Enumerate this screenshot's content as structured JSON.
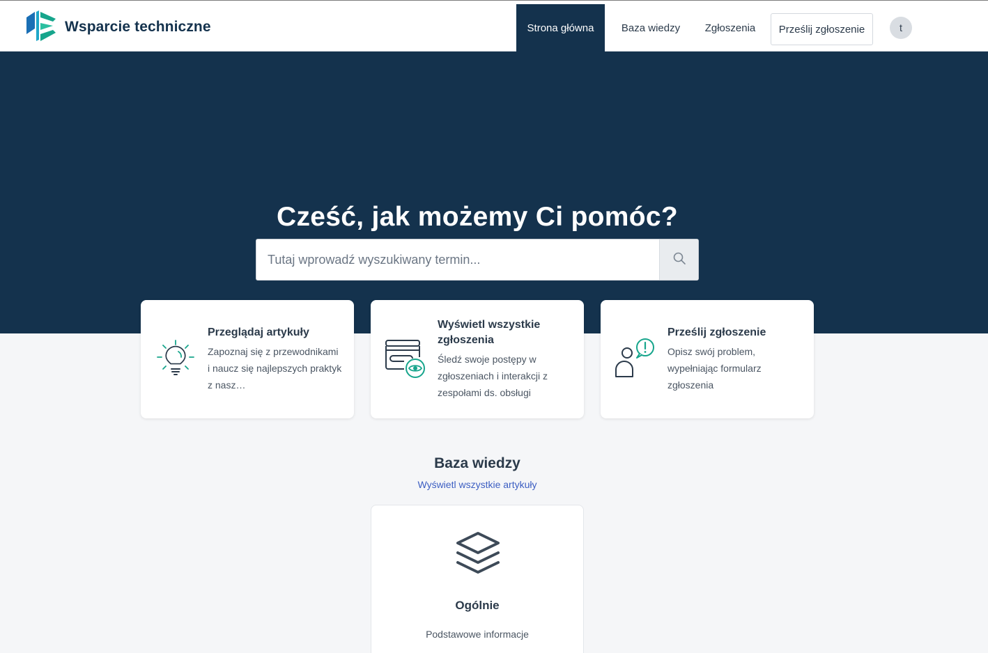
{
  "header": {
    "brand_name": "Wsparcie techniczne",
    "nav": {
      "home": "Strona główna",
      "knowledge_base": "Baza wiedzy",
      "tickets": "Zgłoszenia",
      "submit": "Prześlij zgłoszenie"
    },
    "avatar_initial": "t"
  },
  "hero": {
    "title": "Cześć, jak możemy Ci pomóc?",
    "search_placeholder": "Tutaj wprowadź wyszukiwany termin..."
  },
  "cards": [
    {
      "icon": "lightbulb-icon",
      "title": "Przeglądaj artykuły",
      "description": "Zapoznaj się z przewodnikami i naucz się najlepszych praktyk z nasz…"
    },
    {
      "icon": "tickets-eye-icon",
      "title": "Wyświetl wszystkie zgłoszenia",
      "description": "Śledź swoje postępy w zgłoszeniach i interakcji z zespołami ds. obsługi"
    },
    {
      "icon": "person-alert-icon",
      "title": "Prześlij zgłoszenie",
      "description": "Opisz swój problem, wypełniając formularz zgłoszenia"
    }
  ],
  "knowledge_base": {
    "title": "Baza wiedzy",
    "view_all_link": "Wyświetl wszystkie artykuły",
    "categories": [
      {
        "icon": "layers-icon",
        "title": "Ogólnie",
        "description": "Podstawowe informacje"
      }
    ]
  },
  "colors": {
    "primary": "#14324d",
    "accent_teal": "#17a58c",
    "link": "#3c5ec2",
    "page_background": "#f5f6f8"
  }
}
